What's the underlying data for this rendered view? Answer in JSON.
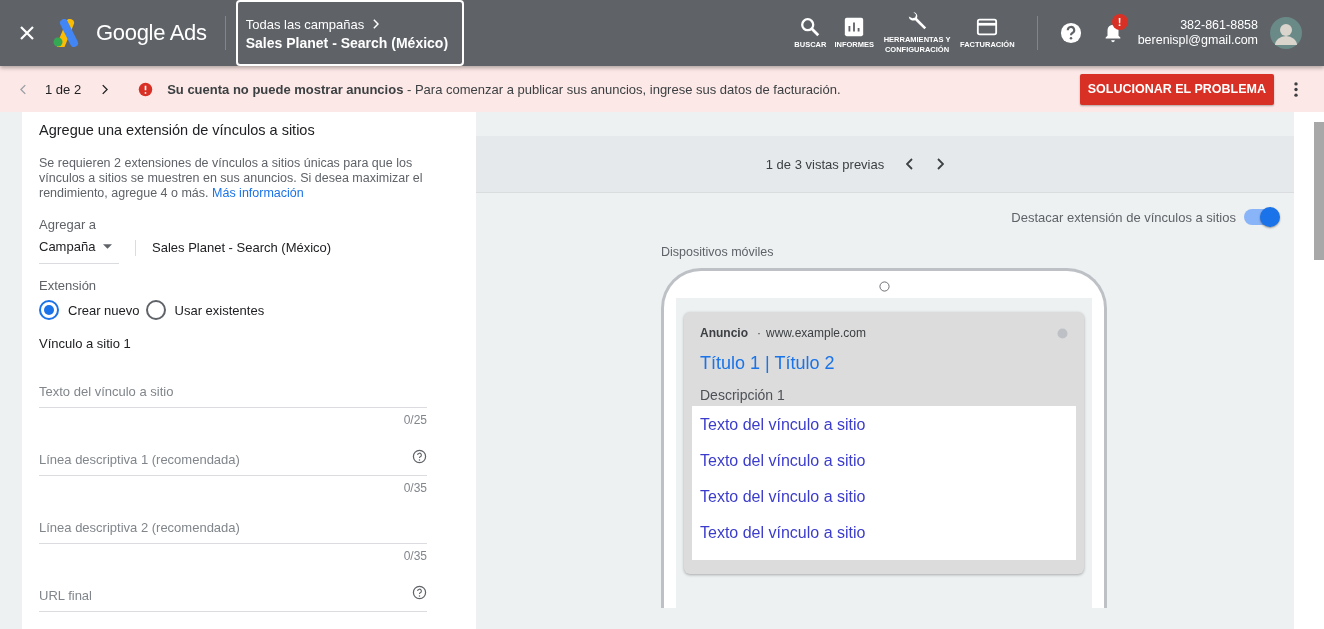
{
  "header": {
    "product": "Google Ads",
    "breadcrumb": "Todas las campañas",
    "campaign": "Sales Planet - Search (México)",
    "nav": [
      {
        "kind": "search",
        "label": "BUSCAR"
      },
      {
        "kind": "reports",
        "label": "INFORMES"
      },
      {
        "kind": "tools",
        "label": "HERRAMIENTAS Y CONFIGURACIÓN"
      },
      {
        "kind": "billing",
        "label": "FACTURACIÓN"
      }
    ],
    "notification_alert": "!",
    "phone": "382-861-8858",
    "email": "berenispl@gmail.com"
  },
  "alert": {
    "pager": "1 de 2",
    "title": "Su cuenta no puede mostrar anuncios",
    "message": " - Para comenzar a publicar sus anuncios, ingrese sus datos de facturación.",
    "action": "SOLUCIONAR EL PROBLEMA"
  },
  "form": {
    "title": "Agregue una extensión de vínculos a sitios",
    "description": "Se requieren 2 extensiones de vínculos a sitios únicas para que los vínculos a sitios se muestren en sus anuncios. Si desea maximizar el rendimiento, agregue 4 o más.",
    "link": "Más información",
    "add_to_label": "Agregar a",
    "level": "Campaña",
    "campaign": "Sales Planet - Search (México)",
    "extension_label": "Extensión",
    "options": [
      {
        "label": "Crear nuevo",
        "selected": true
      },
      {
        "label": "Usar existentes",
        "selected": false
      }
    ],
    "section": "Vínculo a sitio 1",
    "fields": [
      {
        "placeholder": "Texto del vínculo a sitio",
        "help": false,
        "counter": "0/25"
      },
      {
        "placeholder": "Línea descriptiva 1 (recomendada)",
        "help": true,
        "counter": "0/35"
      },
      {
        "placeholder": "Línea descriptiva 2 (recomendada)",
        "help": false,
        "counter": "0/35"
      },
      {
        "placeholder": "URL final",
        "help": true
      }
    ]
  },
  "preview": {
    "pager": "1 de 3 vistas previas",
    "highlight_label": "Destacar extensión de vínculos a sitios",
    "highlight_on": true,
    "device": "Dispositivos móviles",
    "ad_label": "Anuncio",
    "separator": "·",
    "url": "www.example.com",
    "headline": "Título 1 | Título 2",
    "description": "Descripción 1",
    "sitelinks": [
      "Texto del vínculo a sitio",
      "Texto del vínculo a sitio",
      "Texto del vínculo a sitio",
      "Texto del vínculo a sitio"
    ]
  }
}
